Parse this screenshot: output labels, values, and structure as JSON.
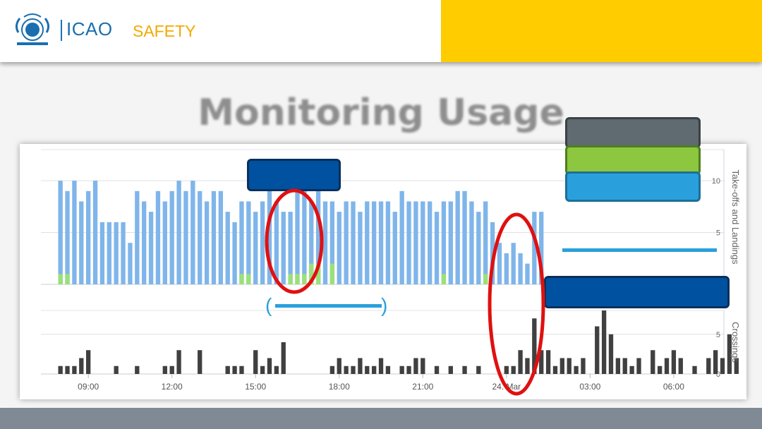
{
  "header": {
    "brand": "ICAO",
    "section": "SAFETY",
    "colors": {
      "brand_blue": "#1a6fb0",
      "section_orange": "#f2a900",
      "accent_yellow": "#ffcc00"
    }
  },
  "slide": {
    "title": "Monitoring Usage"
  },
  "chart_data": [
    {
      "type": "bar",
      "panel": "top",
      "ylabel": "Take-offs and Landings",
      "ylim": [
        0,
        13
      ],
      "yticks": [
        5,
        10
      ],
      "xlim": [
        7.3,
        31.8
      ],
      "bar_width_hours": 0.16,
      "series": [
        {
          "color": "#7fb5ea",
          "x": [
            8,
            8.25,
            8.5,
            8.75,
            9,
            9.25,
            9.5,
            9.75,
            10,
            10.25,
            10.5,
            10.75,
            11,
            11.25,
            11.5,
            11.75,
            12,
            12.25,
            12.5,
            12.75,
            13,
            13.25,
            13.5,
            13.75,
            14,
            14.25,
            14.5,
            14.75,
            15,
            15.25,
            15.5,
            15.75,
            16,
            16.25,
            16.5,
            16.75,
            17,
            17.25,
            17.5,
            17.75,
            18,
            18.25,
            18.5,
            18.75,
            19,
            19.25,
            19.5,
            19.75,
            20,
            20.25,
            20.5,
            20.75,
            21,
            21.25,
            21.5,
            21.75,
            22,
            22.25,
            22.5,
            22.75,
            23,
            23.25,
            23.5,
            23.75,
            24,
            24.25,
            24.5,
            24.75,
            25,
            25.25
          ],
          "values": [
            10,
            9,
            10,
            8,
            9,
            10,
            6,
            6,
            6,
            6,
            4,
            9,
            8,
            7,
            9,
            8,
            9,
            10,
            9,
            10,
            9,
            8,
            9,
            9,
            7,
            6,
            8,
            8,
            7,
            8,
            9,
            8,
            7,
            7,
            9,
            10,
            8,
            9,
            8,
            8,
            7,
            8,
            8,
            7,
            8,
            8,
            8,
            8,
            7,
            9,
            8,
            8,
            8,
            8,
            7,
            8,
            8,
            9,
            9,
            8,
            7,
            8,
            6,
            4,
            3,
            4,
            3,
            2,
            7,
            7
          ]
        },
        {
          "color": "#9be07a",
          "x": [
            8,
            8.25,
            14.5,
            14.75,
            16.25,
            16.5,
            16.75,
            17,
            17.25,
            17.75,
            21.75,
            23.25
          ],
          "values": [
            1,
            1,
            1,
            1,
            1,
            1,
            1,
            2,
            2,
            2,
            1,
            1
          ]
        }
      ]
    },
    {
      "type": "bar",
      "panel": "bottom",
      "ylabel": "Crossings",
      "ylim": [
        0,
        8
      ],
      "yticks": [
        0,
        5
      ],
      "xlim": [
        7.3,
        31.8
      ],
      "xticks": [
        "09:00",
        "12:00",
        "15:00",
        "18:00",
        "21:00",
        "24. Mar",
        "03:00",
        "06:00"
      ],
      "xtick_positions": [
        9,
        12,
        15,
        18,
        21,
        24,
        27,
        30
      ],
      "bar_width_hours": 0.16,
      "series": [
        {
          "color": "#404040",
          "x": [
            8,
            8.25,
            8.5,
            8.75,
            9,
            10,
            10.75,
            11.75,
            12,
            12.25,
            13,
            14,
            14.25,
            14.5,
            15,
            15.25,
            15.5,
            15.75,
            16,
            17.75,
            18,
            18.25,
            18.5,
            18.75,
            19,
            19.25,
            19.5,
            19.75,
            20.25,
            20.5,
            20.75,
            21,
            21.5,
            22,
            22.5,
            23,
            24,
            24.25,
            24.5,
            24.75,
            25,
            25.25,
            25.5,
            25.75,
            26,
            26.25,
            26.5,
            26.75,
            27.25,
            27.5,
            27.75,
            28,
            28.25,
            28.5,
            28.75,
            29.25,
            29.5,
            29.75,
            30,
            30.25,
            30.75,
            31.25,
            31.5,
            31.75,
            32,
            32.25
          ],
          "values": [
            1,
            1,
            1,
            2,
            3,
            1,
            1,
            1,
            1,
            3,
            3,
            1,
            1,
            1,
            3,
            1,
            2,
            1,
            4,
            1,
            2,
            1,
            1,
            2,
            1,
            1,
            2,
            1,
            1,
            1,
            2,
            2,
            1,
            1,
            1,
            1,
            1,
            1,
            3,
            2,
            7,
            3,
            3,
            1,
            2,
            2,
            1,
            2,
            6,
            8,
            5,
            2,
            2,
            1,
            2,
            3,
            1,
            2,
            3,
            2,
            1,
            2,
            3,
            2,
            5,
            2
          ]
        }
      ]
    }
  ],
  "annotations": {
    "highlight_colors": [
      "#5f6b70",
      "#8dc63f",
      "#29a0db"
    ],
    "dark_box_color": "#0051a0",
    "circle_color": "#e01010",
    "line_color": "#29a0db"
  }
}
